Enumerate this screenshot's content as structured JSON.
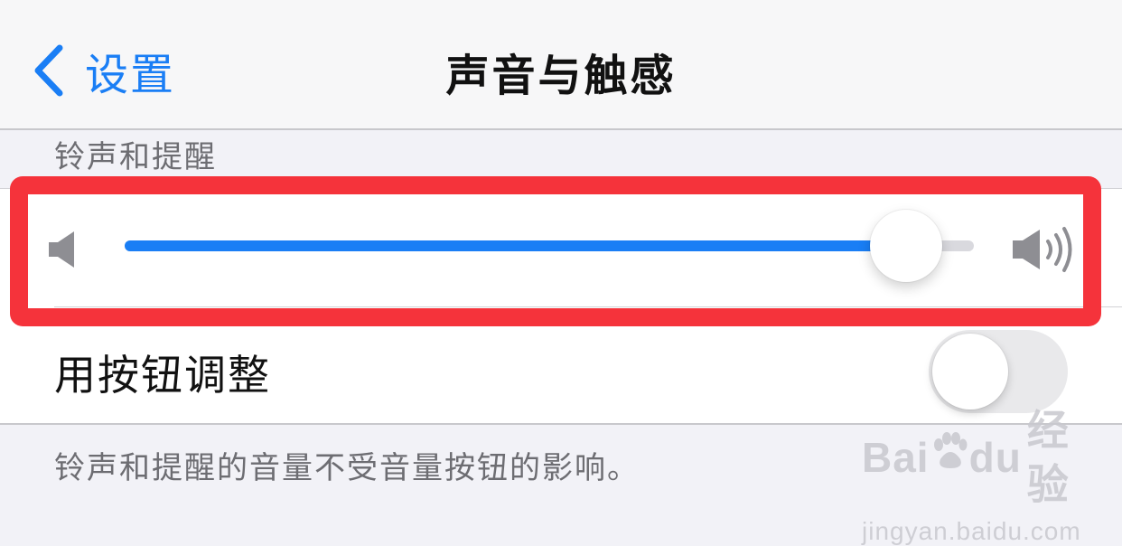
{
  "nav": {
    "back_label": "设置",
    "title": "声音与触感"
  },
  "section": {
    "header": "铃声和提醒"
  },
  "volume": {
    "level_percent": 92,
    "low_icon": "speaker-low-icon",
    "high_icon": "speaker-high-icon"
  },
  "toggle_row": {
    "label": "用按钮调整",
    "enabled": false
  },
  "footer": {
    "note": "铃声和提醒的音量不受音量按钮的影响。"
  },
  "watermark": {
    "brand_a": "Bai",
    "brand_b": "du",
    "brand_cn": "经验",
    "url": "jingyan.baidu.com"
  },
  "colors": {
    "accent": "#1a7ef5",
    "highlight": "#f5333b",
    "background": "#f2f2f7",
    "toggle_off": "#e9e9eb"
  }
}
